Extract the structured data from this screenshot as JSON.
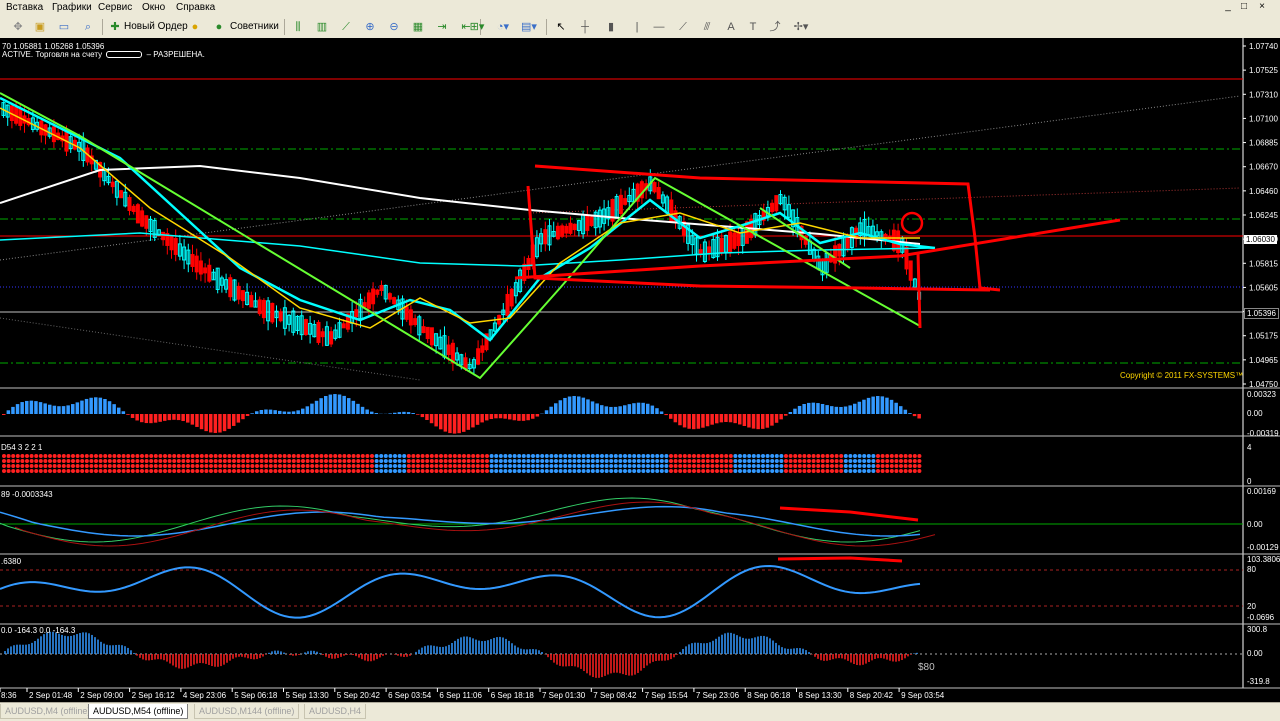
{
  "menu": {
    "items": [
      "Вставка",
      "Графики",
      "Сервис",
      "Окно",
      "Справка"
    ],
    "window_buttons": [
      "_",
      "□",
      "×"
    ]
  },
  "toolbar": {
    "new_order_label": "Новый Ордер",
    "experts_label": "Советники"
  },
  "chart": {
    "ohlc_text": "70 1.05881 1.05268 1.05396",
    "status_prefix": "ACTIVE. Торговля на счету",
    "status_suffix": "– РАЗРЕШЕНА.",
    "copyright": "Copyright © 2011 FX-SYSTEMS™",
    "current_price": "1.05396",
    "price_box_highlight": "1.06030",
    "price_labels": [
      "1.07740",
      "1.07525",
      "1.07310",
      "1.07100",
      "1.06885",
      "1.06670",
      "1.06460",
      "1.06245",
      "1.06030",
      "1.05815",
      "1.05605",
      "1.05396",
      "1.05175",
      "1.04965",
      "1.04750"
    ],
    "time_labels": [
      "8:36",
      "2 Sep 01:48",
      "2 Sep 09:00",
      "2 Sep 16:12",
      "4 Sep 23:06",
      "5 Sep 06:18",
      "5 Sep 13:30",
      "5 Sep 20:42",
      "6 Sep 03:54",
      "6 Sep 11:06",
      "6 Sep 18:18",
      "7 Sep 01:30",
      "7 Sep 08:42",
      "7 Sep 15:54",
      "7 Sep 23:06",
      "8 Sep 06:18",
      "8 Sep 13:30",
      "8 Sep 20:42",
      "9 Sep 03:54"
    ],
    "annotation_80": "$80"
  },
  "panels": {
    "p1": {
      "scale": [
        "0.00323",
        "0.00",
        "-0.00319"
      ]
    },
    "p2": {
      "title": "D54 3 2 2 1",
      "scale": [
        "4",
        "0"
      ]
    },
    "p3": {
      "title": "89 -0.0003343",
      "scale": [
        "0.00169",
        "0.00",
        "-0.00129"
      ]
    },
    "p4": {
      "title": ".6380",
      "scale": [
        "103.3806",
        "80",
        "20",
        "-0.0696"
      ]
    },
    "p5": {
      "title": "0.0 -164.3 0.0 -164.3",
      "scale": [
        "300.8",
        "0.00",
        "-319.8"
      ]
    }
  },
  "tabs": [
    "AUDUSD,M4 (offline)",
    "AUDUSD,M54 (offline)",
    "AUDUSD,M144 (offline)",
    "AUDUSD,H4"
  ],
  "colors": {
    "bull_candle": "#00ffff",
    "bear_candle": "#ff0000",
    "ma_cyan": "#00ffff",
    "ma_yellow": "#ffd700",
    "ma_white": "#ffffff",
    "drawing_red": "#ff0000",
    "drawing_green": "#66ff33",
    "hist_blue": "#3399ff",
    "hist_red": "#ff2020"
  }
}
